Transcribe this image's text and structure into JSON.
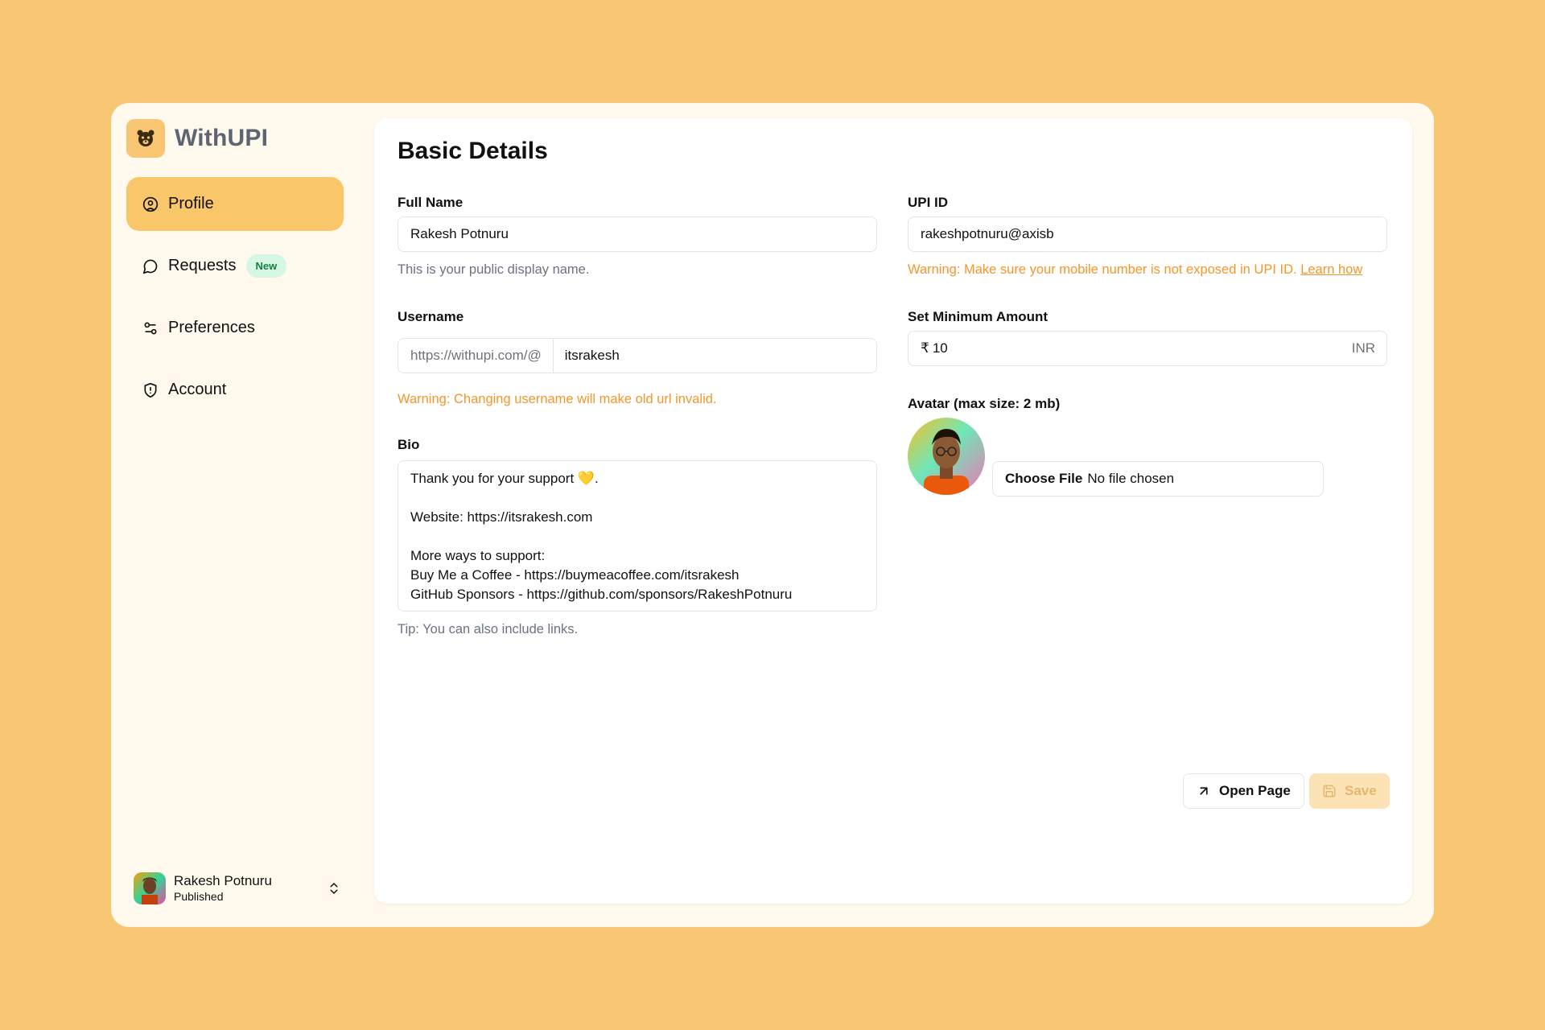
{
  "app": {
    "name": "WithUPI"
  },
  "colors": {
    "background": "#F8C572",
    "accent": "#F9C66A",
    "warning": "#F5962A",
    "badge_bg": "#D6F7E4",
    "badge_text": "#16803F"
  },
  "sidebar": {
    "items": [
      {
        "label": "Profile",
        "icon": "user-circle-icon",
        "active": true
      },
      {
        "label": "Requests",
        "icon": "message-circle-icon",
        "badge": "New"
      },
      {
        "label": "Preferences",
        "icon": "sliders-icon"
      },
      {
        "label": "Account",
        "icon": "shield-icon"
      }
    ],
    "user": {
      "name": "Rakesh Potnuru",
      "status": "Published"
    }
  },
  "main": {
    "title": "Basic Details",
    "full_name": {
      "label": "Full Name",
      "value": "Rakesh Potnuru",
      "hint": "This is your public display name."
    },
    "username": {
      "label": "Username",
      "prefix": "https://withupi.com/@",
      "value": "itsrakesh",
      "warning": "Warning: Changing username will make old url invalid."
    },
    "bio": {
      "label": "Bio",
      "lines": [
        "Thank you for your support 💛.",
        "",
        "Website: https://itsrakesh.com",
        "",
        "More ways to support:",
        "Buy Me a Coffee - https://buymeacoffee.com/itsrakesh",
        "GitHub Sponsors - https://github.com/sponsors/RakeshPotnuru"
      ],
      "hint": "Tip: You can also include links."
    },
    "upi": {
      "label": "UPI ID",
      "value": "rakeshpotnuru@axisb",
      "warning": "Warning: Make sure your mobile number is not exposed in UPI ID.",
      "warning_link": "Learn how"
    },
    "min_amount": {
      "label": "Set Minimum Amount",
      "currency_symbol": "₹",
      "value": "10",
      "suffix": "INR"
    },
    "avatar": {
      "label": "Avatar (max size: 2 mb)",
      "choose_label": "Choose File",
      "file_status": "No file chosen"
    },
    "buttons": {
      "open_page": "Open Page",
      "save": "Save"
    }
  }
}
